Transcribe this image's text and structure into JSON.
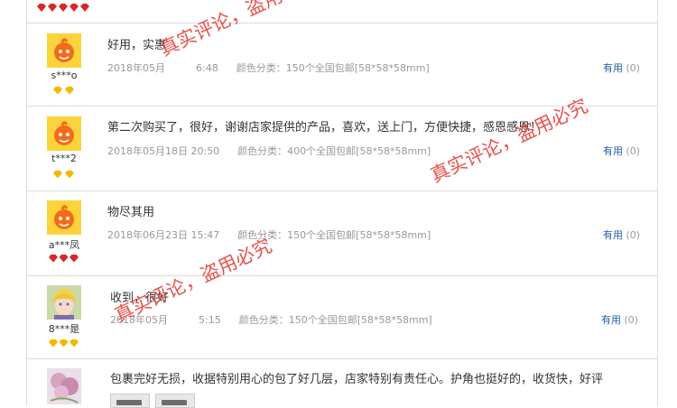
{
  "reviews": [
    {
      "username": "s***o",
      "text": "好用，实惠",
      "date": "2018年05月",
      "date_tail": "6:48",
      "spec": "颜色分类：150个全国包邮[58*58*58mm]",
      "useful_label": "有用",
      "useful_count": "(0)"
    },
    {
      "username": "t***2",
      "text": "第二次购买了，很好，谢谢店家提供的产品，喜欢，送上门，方便快捷，感恩感恩！",
      "date": "2018年05月18日 20:50",
      "spec": "颜色分类：400个全国包邮[58*58*58mm]",
      "useful_label": "有用",
      "useful_count": "(0)"
    },
    {
      "username": "a***凤",
      "text": "物尽其用",
      "date": "2018年06月23日 15:47",
      "spec": "颜色分类：150个全国包邮[58*58*58mm]",
      "useful_label": "有用",
      "useful_count": "(0)"
    },
    {
      "username": "8***是",
      "text": "收到，很好",
      "date": "2018年05月",
      "date_tail": "5:15",
      "spec": "颜色分类：150个全国包邮[58*58*58mm]",
      "useful_label": "有用",
      "useful_count": "(0)"
    },
    {
      "username": "",
      "text": "包裹完好无损，收据特别用心的包了好几层，店家特别有责任心。护角也挺好的，收货快，好评"
    }
  ],
  "watermarks": [
    {
      "text": "真实评论，盗用"
    },
    {
      "text": "真实评论，盗用必究"
    },
    {
      "text": "真实评论，盗用必究"
    }
  ],
  "colors": {
    "watermark": "#e5352f",
    "link": "#1f5fa8",
    "border": "#dcdcdc"
  }
}
